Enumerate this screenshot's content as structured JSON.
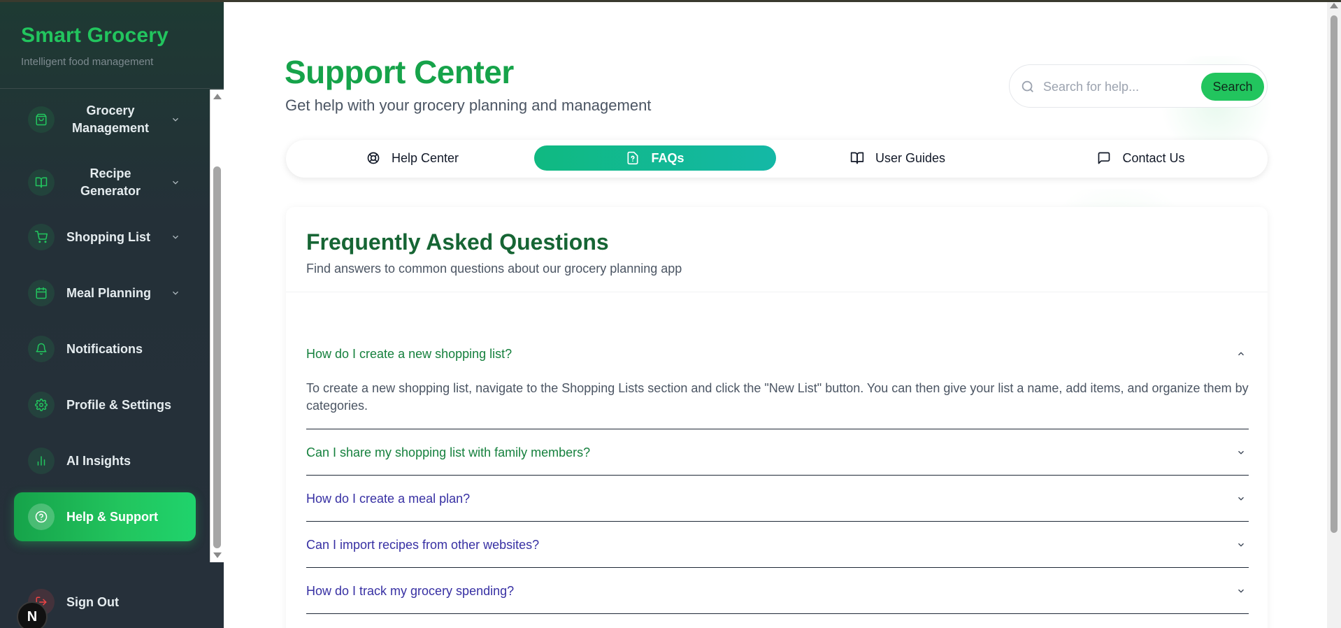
{
  "app": {
    "brand": "Smart Grocery",
    "tagline": "Intelligent food management"
  },
  "sidebar": {
    "items": [
      {
        "label": "Grocery Management",
        "icon": "shopping-bag-icon",
        "has_submenu": true
      },
      {
        "label": "Recipe Generator",
        "icon": "book-open-icon",
        "has_submenu": true
      },
      {
        "label": "Shopping List",
        "icon": "cart-icon",
        "has_submenu": true
      },
      {
        "label": "Meal Planning",
        "icon": "calendar-icon",
        "has_submenu": true
      },
      {
        "label": "Notifications",
        "icon": "bell-icon",
        "has_submenu": false
      },
      {
        "label": "Profile & Settings",
        "icon": "gear-icon",
        "has_submenu": false
      },
      {
        "label": "AI Insights",
        "icon": "bar-chart-icon",
        "has_submenu": false
      },
      {
        "label": "Help & Support",
        "icon": "help-circle-icon",
        "has_submenu": false,
        "active": true
      }
    ],
    "sign_out": "Sign Out",
    "badge": "N"
  },
  "header": {
    "title": "Support Center",
    "subtitle": "Get help with your grocery planning and management"
  },
  "search": {
    "placeholder": "Search for help...",
    "value": "",
    "button_label": "Search"
  },
  "tabs": [
    {
      "label": "Help Center",
      "icon": "lifebuoy-icon"
    },
    {
      "label": "FAQs",
      "icon": "file-question-icon",
      "active": true
    },
    {
      "label": "User Guides",
      "icon": "book-open-icon"
    },
    {
      "label": "Contact Us",
      "icon": "message-square-icon"
    }
  ],
  "faq": {
    "title": "Frequently Asked Questions",
    "description": "Find answers to common questions about our grocery planning app",
    "items": [
      {
        "question": "How do I create a new shopping list?",
        "expanded": true,
        "answer": "To create a new shopping list, navigate to the Shopping Lists section and click the \"New List\" button. You can then give your list a name, add items, and organize them by categories."
      },
      {
        "question": "Can I share my shopping list with family members?",
        "expanded": false
      },
      {
        "question": "How do I create a meal plan?",
        "expanded": false
      },
      {
        "question": "Can I import recipes from other websites?",
        "expanded": false
      },
      {
        "question": "How do I track my grocery spending?",
        "expanded": false
      }
    ]
  },
  "colors": {
    "brand_green": "#22c55e",
    "title_green": "#16a34a",
    "tab_active": "#10b981",
    "link_visited": "#3730a3",
    "sidebar_bg": "#26303a"
  }
}
